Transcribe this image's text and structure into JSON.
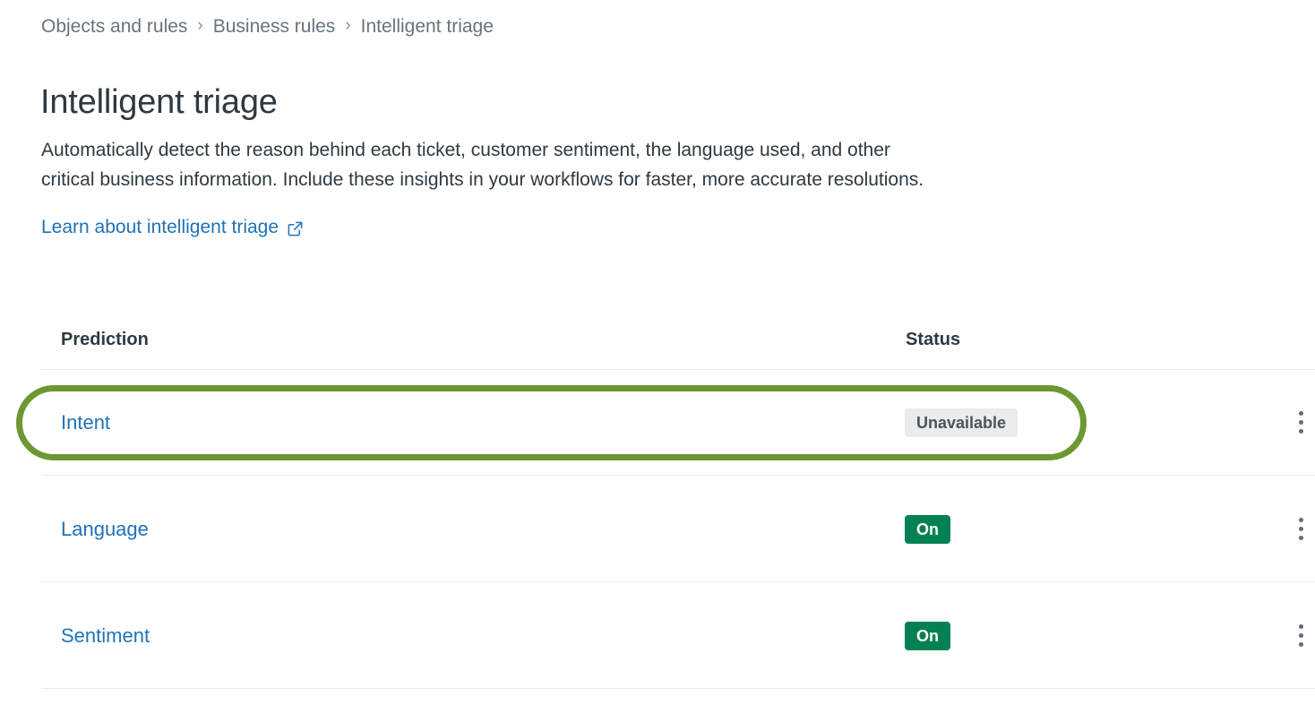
{
  "breadcrumb": {
    "items": [
      {
        "label": "Objects and rules",
        "link": true
      },
      {
        "label": "Business rules",
        "link": true
      },
      {
        "label": "Intelligent triage",
        "link": false
      }
    ],
    "separator": "›"
  },
  "page": {
    "title": "Intelligent triage",
    "description": "Automatically detect the reason behind each ticket, customer sentiment, the language used, and other critical business information. Include these insights in your workflows for faster, more accurate resolutions.",
    "learn_link": "Learn about intelligent triage",
    "learn_link_icon": "external-link-icon"
  },
  "table": {
    "columns": [
      "Prediction",
      "Status"
    ],
    "rows": [
      {
        "prediction": "Intent",
        "status": "Unavailable",
        "status_type": "unavailable",
        "menu_icon": "kebab-menu-icon",
        "highlighted": true
      },
      {
        "prediction": "Language",
        "status": "On",
        "status_type": "on",
        "menu_icon": "kebab-menu-icon",
        "highlighted": false
      },
      {
        "prediction": "Sentiment",
        "status": "On",
        "status_type": "on",
        "menu_icon": "kebab-menu-icon",
        "highlighted": false
      }
    ]
  },
  "annotation": {
    "type": "highlight-rounded-rect",
    "target": "Intent",
    "color": "#6d9733"
  },
  "colors": {
    "link": "#1f73b7",
    "text": "#2f3941",
    "muted": "#68737d",
    "badge_on_bg": "#038153",
    "badge_unavailable_bg": "#e9ebed",
    "divider": "#e9ebed",
    "annotation_green": "#6d9733"
  }
}
